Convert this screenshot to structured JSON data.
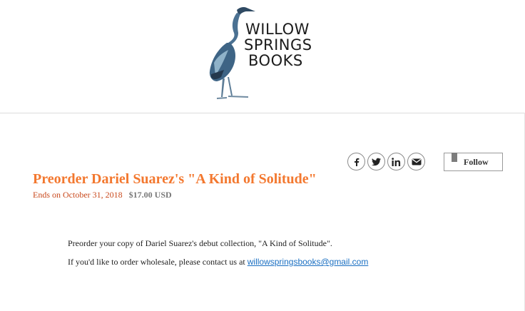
{
  "logo": {
    "icon": "heron-icon",
    "line1": "WILLOW",
    "line2": "SPRINGS",
    "line3": "BOOKS"
  },
  "share": {
    "facebook": "facebook-icon",
    "twitter": "twitter-icon",
    "linkedin": "linkedin-icon",
    "email": "email-icon"
  },
  "follow": {
    "label": "Follow",
    "icon": "bookmark-icon"
  },
  "product": {
    "title": "Preorder Dariel Suarez's \"A Kind of Solitude\"",
    "ends": "Ends on October 31, 2018",
    "price": "$17.00 USD"
  },
  "description": {
    "para1": "Preorder your copy of Dariel Suarez's debut collection, \"A Kind of Solitude\".",
    "para2_prefix": "If you'd like to order wholesale, please contact us at ",
    "email": "willowspringsbooks@gmail.com"
  },
  "colors": {
    "title": "#f3782f",
    "ends": "#c9491c",
    "link": "#1a6fc2"
  }
}
